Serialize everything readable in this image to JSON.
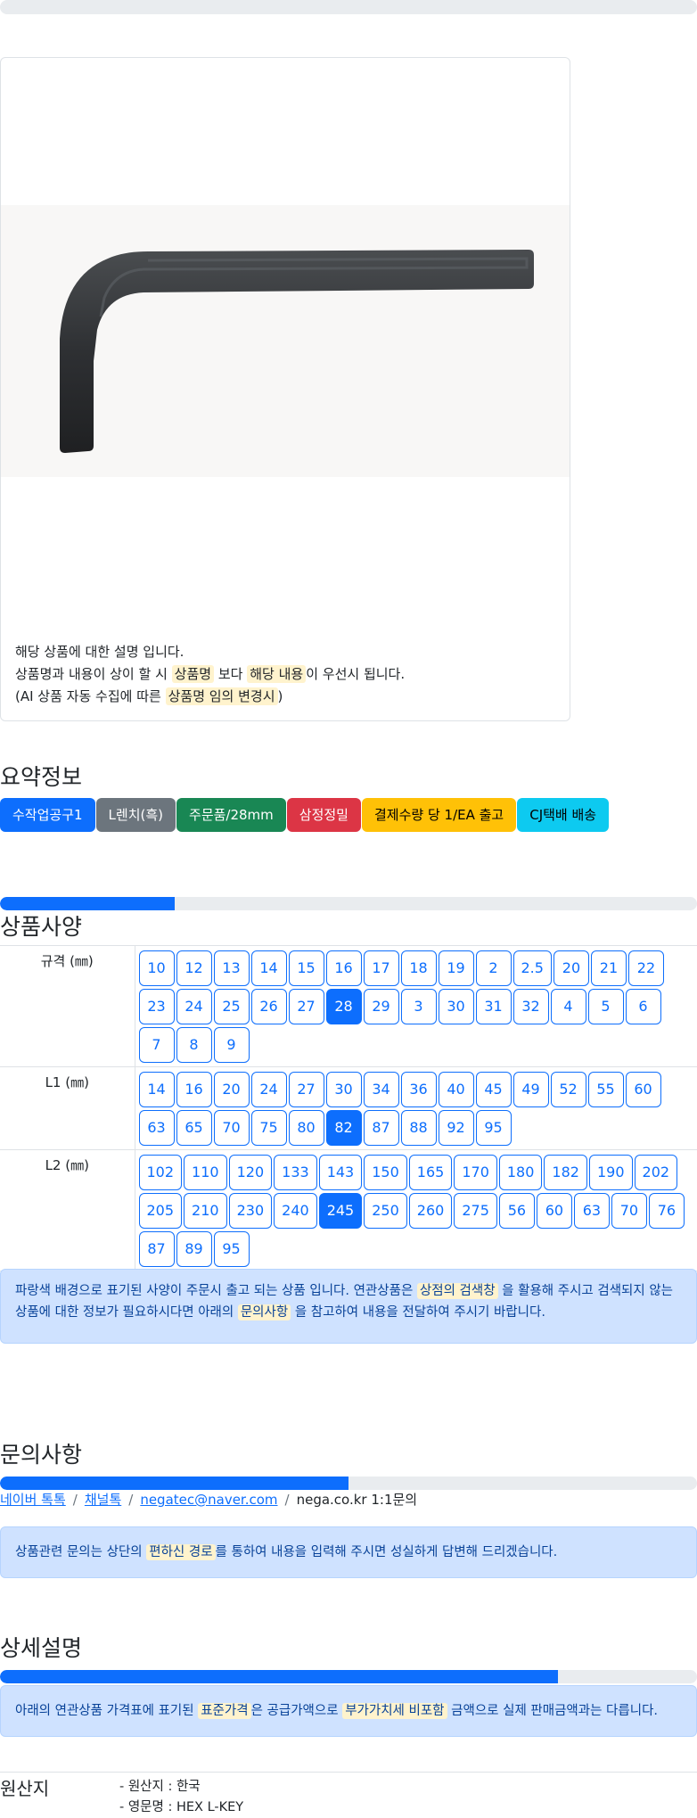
{
  "colors": {
    "primary": "#0d6efd",
    "secondary": "#6c757d",
    "success": "#198754",
    "danger": "#dc3545",
    "warning": "#ffc107",
    "info": "#0dcaf0",
    "alert_bg": "#cfe2ff",
    "highlight": "#fff3cd"
  },
  "product_card": {
    "image_icon": "hex-l-key-image",
    "desc": {
      "line1": "해당 상품에 대한 설명 입니다.",
      "line2_a": "상품명과 내용이 상이 할 시",
      "line2_hl1": "상품명",
      "line2_b": "보다",
      "line2_hl2": "해당 내용",
      "line2_c": "이 우선시 됩니다.",
      "line3_a": "(AI 상품 자동 수집에 따른",
      "line3_hl": "상품명 임의 변경시",
      "line3_b": ")"
    }
  },
  "summary": {
    "title": "요약정보",
    "badges": [
      {
        "label": "수작업공구1",
        "color": "#0d6efd",
        "text_color": "#ffffff"
      },
      {
        "label": "L렌치(흑)",
        "color": "#6c757d",
        "text_color": "#ffffff"
      },
      {
        "label": "주문품/28mm",
        "color": "#198754",
        "text_color": "#ffffff"
      },
      {
        "label": "삼정정밀",
        "color": "#dc3545",
        "text_color": "#ffffff"
      },
      {
        "label": "결제수량 당 1/EA 출고",
        "color": "#ffc107",
        "text_color": "#000000"
      },
      {
        "label": "CJ택배 배송",
        "color": "#0dcaf0",
        "text_color": "#000000"
      }
    ]
  },
  "spec": {
    "progress": 25,
    "title": "상품사양",
    "rows": [
      {
        "label": "규격 (㎜)",
        "options": [
          "10",
          "12",
          "13",
          "14",
          "15",
          "16",
          "17",
          "18",
          "19",
          "2",
          "2.5",
          "20",
          "21",
          "22",
          "23",
          "24",
          "25",
          "26",
          "27",
          "28",
          "29",
          "3",
          "30",
          "31",
          "32",
          "4",
          "5",
          "6",
          "7",
          "8",
          "9"
        ],
        "selected": "28"
      },
      {
        "label": "L1 (㎜)",
        "options": [
          "14",
          "16",
          "20",
          "24",
          "27",
          "30",
          "34",
          "36",
          "40",
          "45",
          "49",
          "52",
          "55",
          "60",
          "63",
          "65",
          "70",
          "75",
          "80",
          "82",
          "87",
          "88",
          "92",
          "95"
        ],
        "selected": "82"
      },
      {
        "label": "L2 (㎜)",
        "options": [
          "102",
          "110",
          "120",
          "133",
          "143",
          "150",
          "165",
          "170",
          "180",
          "182",
          "190",
          "202",
          "205",
          "210",
          "230",
          "240",
          "245",
          "250",
          "260",
          "275",
          "56",
          "60",
          "63",
          "70",
          "76",
          "87",
          "89",
          "95"
        ],
        "selected": "245"
      }
    ],
    "notice": {
      "a": "파랑색 배경으로 표기된 사양이 주문시 출고 되는 상품 입니다. 연관상품은",
      "hl1": "상점의 검색창",
      "b": "을 활용해 주시고 검색되지 않는 상품에 대한 정보가 필요하시다면 아래의",
      "hl2": "문의사항",
      "c": "을 참고하여 내용을 전달하여 주시기 바랍니다."
    }
  },
  "inquiry": {
    "title": "문의사항",
    "progress": 50,
    "links": [
      "네이버 톡톡",
      "채널톡",
      "negatec@naver.com"
    ],
    "last": "nega.co.kr 1:1문의",
    "notice": {
      "a": "상품관련 문의는 상단의",
      "hl": "편하신 경로",
      "b": "를 통하여 내용을 입력해 주시면 성실하게 답변해 드리겠습니다."
    }
  },
  "detail": {
    "title": "상세설명",
    "progress": 80,
    "notice": {
      "a": "아래의 연관상품 가격표에 표기된",
      "hl1": "표준가격",
      "b": "은 공급가액으로",
      "hl2": "부가가치세 비포함",
      "c": "금액으로 실제 판매금액과는 다릅니다."
    }
  },
  "origin": {
    "title": "원산지",
    "line1": "- 원산지 : 한국",
    "line2": "- 영문명 : HEX L-KEY"
  }
}
